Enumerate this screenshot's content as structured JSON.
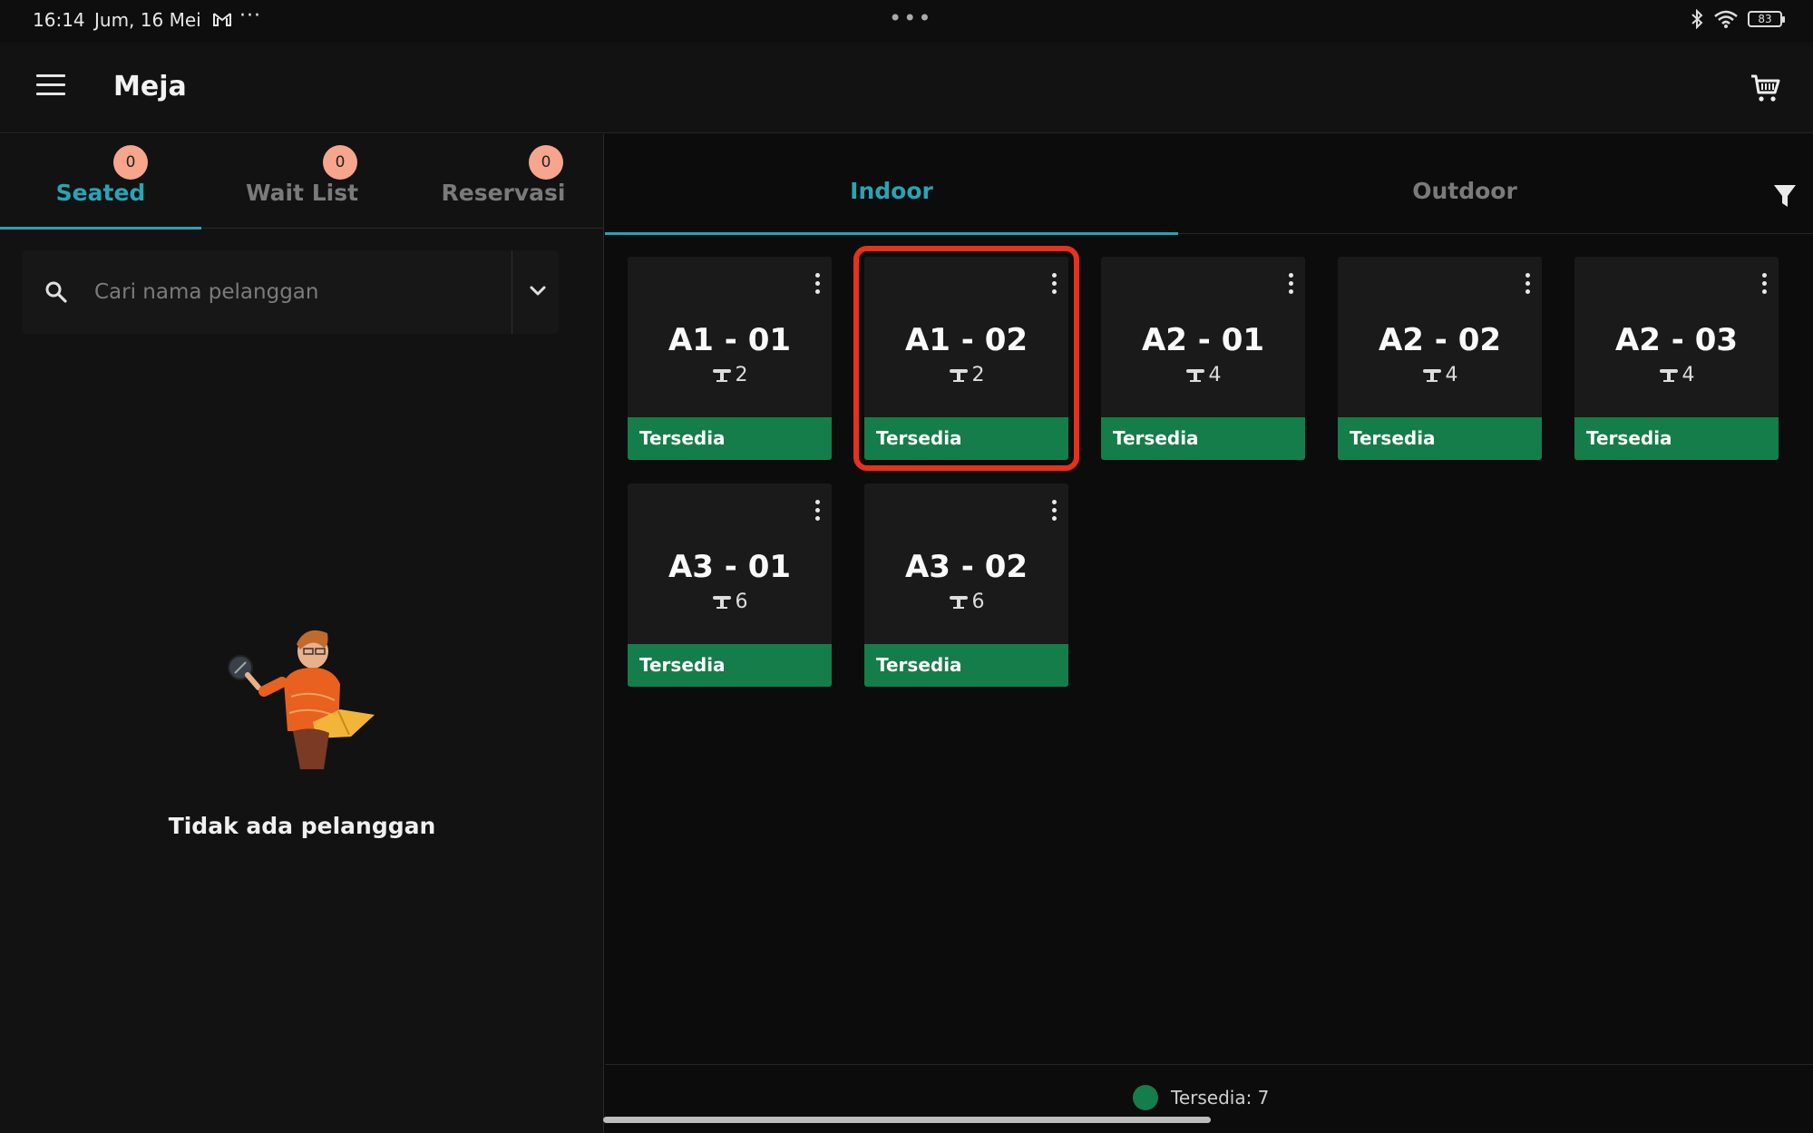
{
  "status_bar": {
    "time": "16:14",
    "date": "Jum, 16 Mei",
    "more": "···",
    "center": "•••",
    "battery": "83"
  },
  "app_bar": {
    "title": "Meja"
  },
  "left_tabs": [
    {
      "label": "Seated",
      "badge": "0",
      "active": true
    },
    {
      "label": "Wait List",
      "badge": "0",
      "active": false
    },
    {
      "label": "Reservasi",
      "badge": "0",
      "active": false
    }
  ],
  "search": {
    "placeholder": "Cari nama pelanggan"
  },
  "empty_state": {
    "text": "Tidak ada pelanggan"
  },
  "right_tabs": [
    {
      "label": "Indoor",
      "active": true
    },
    {
      "label": "Outdoor",
      "active": false
    }
  ],
  "tables": [
    {
      "name": "A1 - 01",
      "seats": "2",
      "status": "Tersedia"
    },
    {
      "name": "A1 - 02",
      "seats": "2",
      "status": "Tersedia"
    },
    {
      "name": "A2 - 01",
      "seats": "4",
      "status": "Tersedia"
    },
    {
      "name": "A2 - 02",
      "seats": "4",
      "status": "Tersedia"
    },
    {
      "name": "A2 - 03",
      "seats": "4",
      "status": "Tersedia"
    },
    {
      "name": "A3 - 01",
      "seats": "6",
      "status": "Tersedia"
    },
    {
      "name": "A3 - 02",
      "seats": "6",
      "status": "Tersedia"
    }
  ],
  "legend": {
    "text": "Tersedia: 7",
    "color": "#157d49"
  },
  "colors": {
    "accent": "#2aa3b4",
    "available": "#157d49",
    "badge": "#f8a58e",
    "highlight": "#e8301c"
  }
}
